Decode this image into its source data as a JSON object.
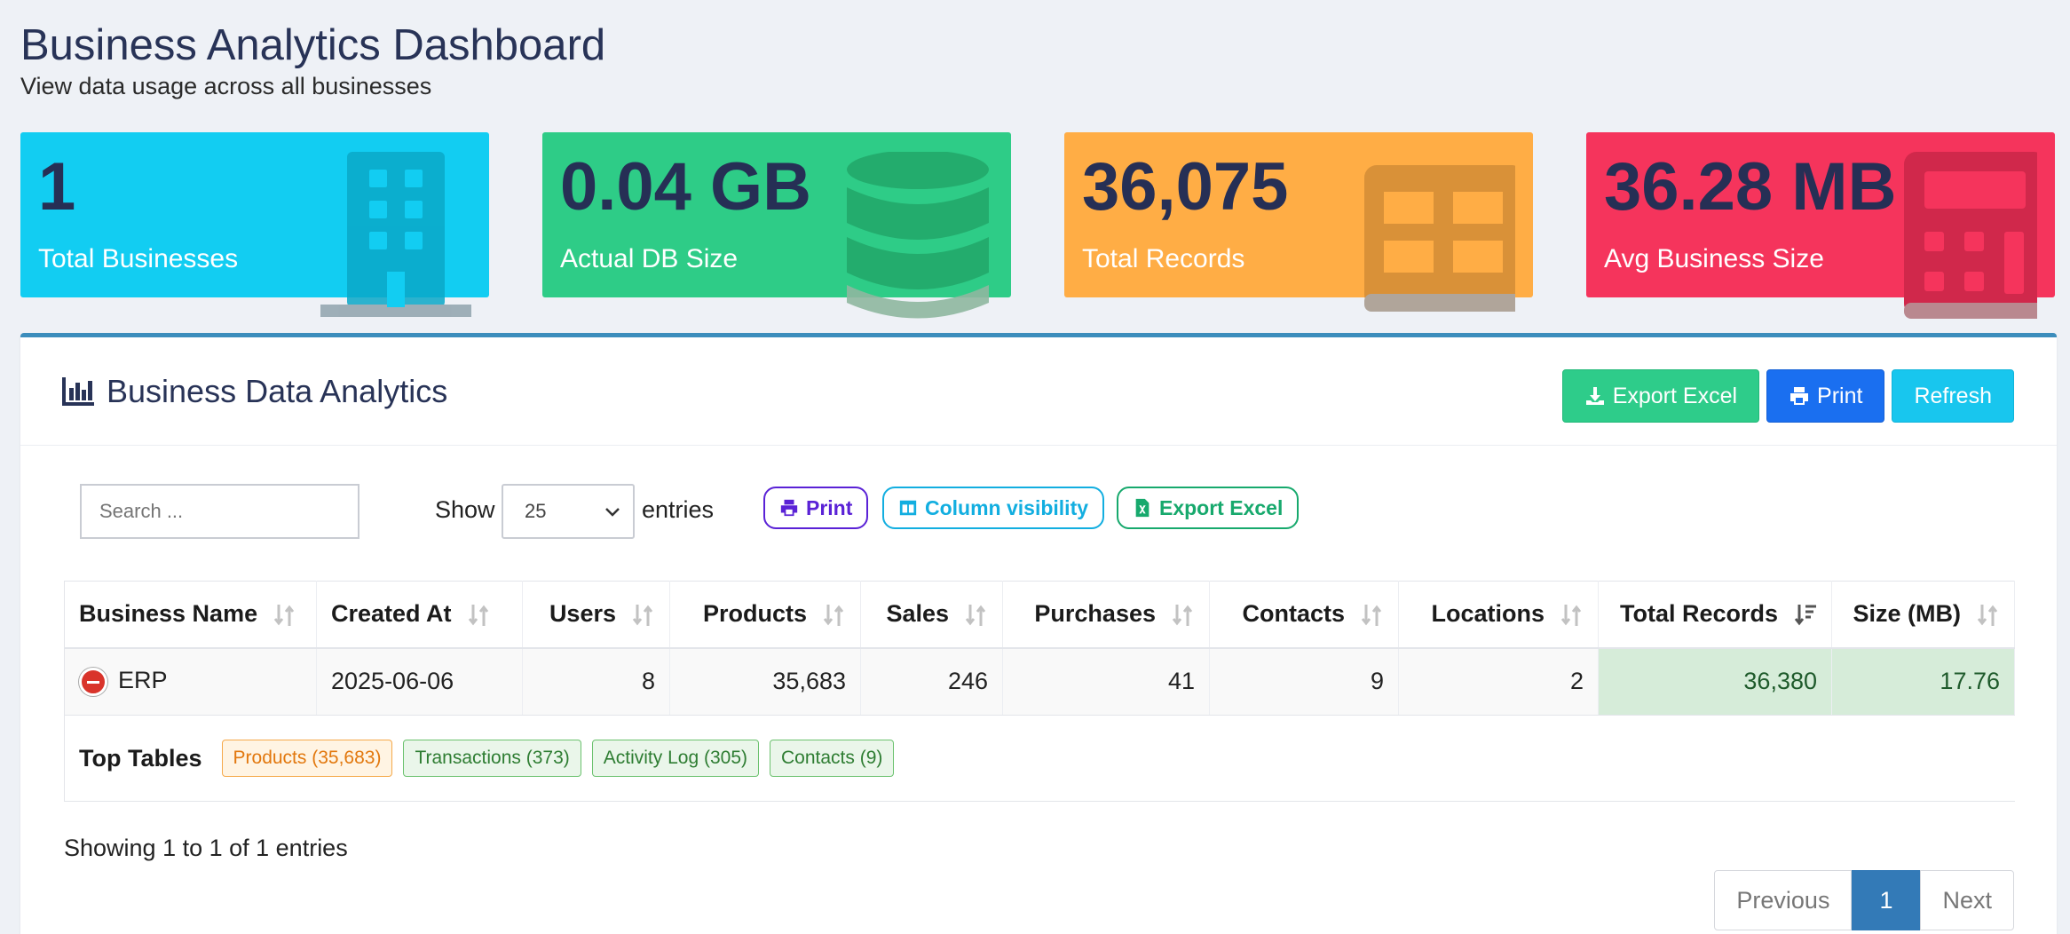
{
  "header": {
    "title": "Business Analytics Dashboard",
    "subtitle": "View data usage across all businesses"
  },
  "cards": [
    {
      "value": "1",
      "label": "Total Businesses",
      "color": "#12cdf2",
      "icon": "building-icon"
    },
    {
      "value": "0.04 GB",
      "label": "Actual DB Size",
      "color": "#2ecc87",
      "icon": "database-icon"
    },
    {
      "value": "36,075",
      "label": "Total Records",
      "color": "#ffad45",
      "icon": "table-icon"
    },
    {
      "value": "36.28 MB",
      "label": "Avg Business Size",
      "color": "#f5345c",
      "icon": "calculator-icon"
    }
  ],
  "panel": {
    "title": "Business Data Analytics",
    "accent": "#3c8dbc",
    "buttons": {
      "export": "Export Excel",
      "print": "Print",
      "refresh": "Refresh"
    }
  },
  "controls": {
    "search_placeholder": "Search ...",
    "show_label": "Show",
    "entries_value": "25",
    "entries_label": "entries",
    "print": "Print",
    "column_visibility": "Column visibility",
    "export_excel": "Export Excel"
  },
  "table": {
    "columns": [
      "Business Name",
      "Created At",
      "Users",
      "Products",
      "Sales",
      "Purchases",
      "Contacts",
      "Locations",
      "Total Records",
      "Size (MB)"
    ],
    "rows": [
      {
        "business_name": "ERP",
        "created_at": "2025-06-06",
        "users": "8",
        "products": "35,683",
        "sales": "246",
        "purchases": "41",
        "contacts": "9",
        "locations": "2",
        "total_records": "36,380",
        "size_mb": "17.76"
      }
    ],
    "child": {
      "label": "Top Tables",
      "tags": [
        "Products (35,683)",
        "Transactions (373)",
        "Activity Log (305)",
        "Contacts (9)"
      ]
    }
  },
  "footer": {
    "info": "Showing 1 to 1 of 1 entries",
    "pager": {
      "previous": "Previous",
      "current": "1",
      "next": "Next"
    }
  }
}
